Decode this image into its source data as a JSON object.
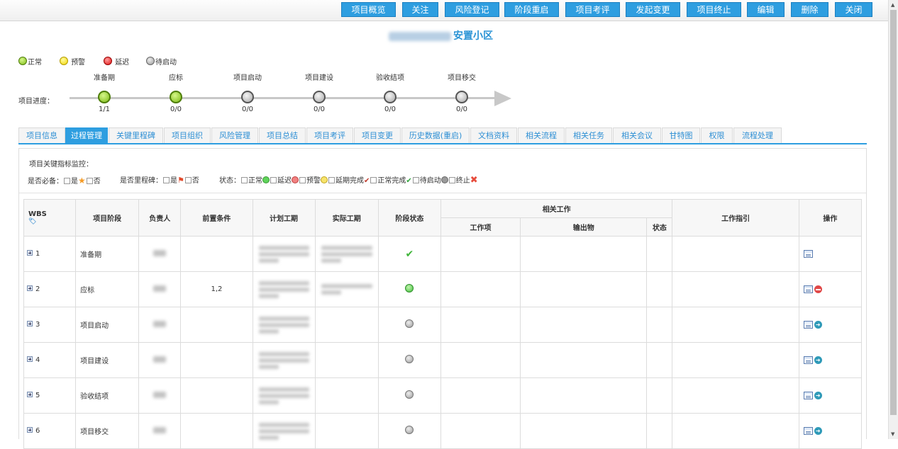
{
  "toolbar": {
    "buttons": [
      {
        "label": "项目概览",
        "name": "overview"
      },
      {
        "label": "关注",
        "name": "follow"
      },
      {
        "label": "风险登记",
        "name": "risk-register"
      },
      {
        "label": "阶段重启",
        "name": "stage-restart"
      },
      {
        "label": "项目考评",
        "name": "evaluation"
      },
      {
        "label": "发起变更",
        "name": "initiate-change"
      },
      {
        "label": "项目终止",
        "name": "terminate"
      },
      {
        "label": "编辑",
        "name": "edit"
      },
      {
        "label": "删除",
        "name": "delete"
      },
      {
        "label": "关闭",
        "name": "close"
      }
    ]
  },
  "project": {
    "title_suffix": "安置小区"
  },
  "legend": {
    "normal": "正常",
    "warning": "预警",
    "delay": "延迟",
    "pending": "待启动"
  },
  "progress": {
    "label": "项目进度：",
    "stages": [
      {
        "name": "准备期",
        "count": "1/1",
        "status": "green"
      },
      {
        "name": "应标",
        "count": "0/0",
        "status": "green"
      },
      {
        "name": "项目启动",
        "count": "0/0",
        "status": "grey"
      },
      {
        "name": "项目建设",
        "count": "0/0",
        "status": "grey"
      },
      {
        "name": "验收结项",
        "count": "0/0",
        "status": "grey"
      },
      {
        "name": "项目移交",
        "count": "0/0",
        "status": "grey"
      }
    ]
  },
  "tabs": [
    "项目信息",
    "过程管理",
    "关键里程碑",
    "项目组织",
    "风险管理",
    "项目总结",
    "项目考评",
    "项目变更",
    "历史数据(重启)",
    "文档资料",
    "相关流程",
    "相关任务",
    "相关会议",
    "甘特图",
    "权限",
    "流程处理"
  ],
  "filters": {
    "heading": "项目关键指标监控：",
    "required_label": "是否必备：",
    "yes": "是",
    "no": "否",
    "milestone_label": "是否里程碑：",
    "status_label": "状态：",
    "status_options": [
      "正常",
      "延迟",
      "预警",
      "延期完成",
      "正常完成",
      "待启动",
      "终止"
    ]
  },
  "table": {
    "headers": {
      "wbs": "WBS",
      "stage": "项目阶段",
      "owner": "负责人",
      "precondition": "前置条件",
      "planned": "计划工期",
      "actual": "实际工期",
      "stage_status": "阶段状态",
      "related_work": "相关工作",
      "work_item": "工作项",
      "output": "输出物",
      "status": "状态",
      "guide": "工作指引",
      "ops": "操作"
    },
    "rows": [
      {
        "wbs": "1",
        "stage": "准备期",
        "precondition": "",
        "status": "done"
      },
      {
        "wbs": "2",
        "stage": "应标",
        "precondition": "1,2",
        "status": "green"
      },
      {
        "wbs": "3",
        "stage": "项目启动",
        "precondition": "",
        "status": "grey"
      },
      {
        "wbs": "4",
        "stage": "项目建设",
        "precondition": "",
        "status": "grey"
      },
      {
        "wbs": "5",
        "stage": "验收结项",
        "precondition": "",
        "status": "grey"
      },
      {
        "wbs": "6",
        "stage": "项目移交",
        "precondition": "",
        "status": "grey"
      }
    ]
  },
  "colors": {
    "accent": "#2e9ee0",
    "title": "#2a93d5",
    "green": "#7cba16",
    "grey": "#999999"
  }
}
